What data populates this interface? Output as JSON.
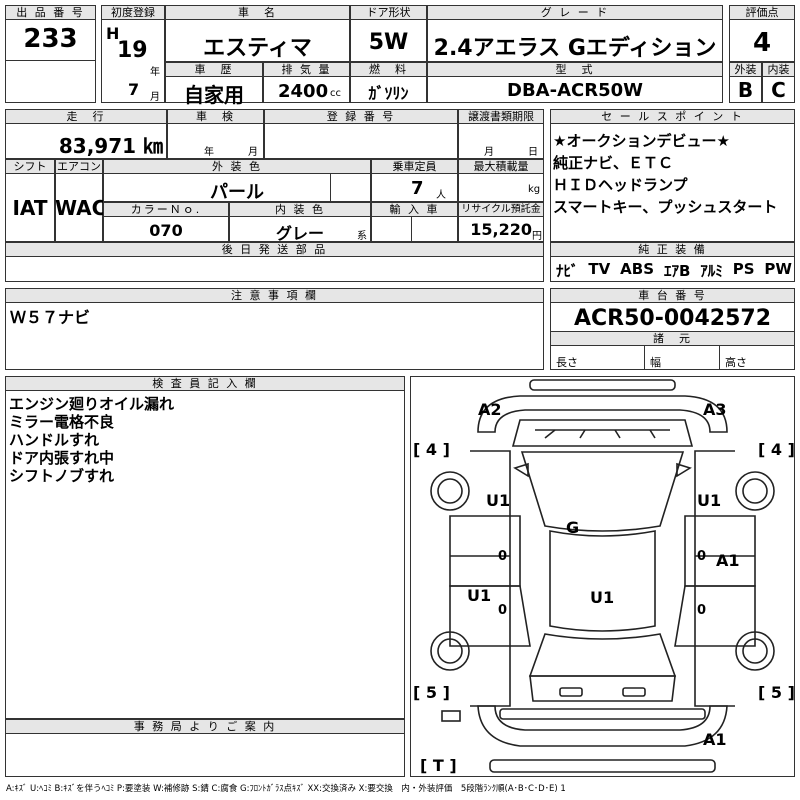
{
  "header": {
    "lot_no_label": "出 品 番 号",
    "lot_no": "233",
    "first_reg_label": "初度登録",
    "era_letter": "H",
    "year_num": "19",
    "year_unit": "年",
    "month_num": "7",
    "month_unit": "月",
    "car_name_label": "車　名",
    "car_name": "エスティマ",
    "door_label": "ドア形状",
    "door": "5W",
    "grade_label": "グ レ ー ド",
    "grade": "2.4アエラス Gエディション",
    "score_label": "評価点",
    "score": "4",
    "history_label": "車　歴",
    "history": "自家用",
    "displacement_label": "排 気 量",
    "displacement": "2400",
    "displacement_unit": "cc",
    "fuel_label": "燃　料",
    "fuel": "ｶﾞｿﾘﾝ",
    "model_label": "型　式",
    "model": "DBA-ACR50W",
    "exterior_label": "外装",
    "exterior": "B",
    "interior_label": "内装",
    "interior": "C"
  },
  "row2": {
    "mileage_label": "走　行",
    "mileage": "83,971 ㎞",
    "inspection_label": "車　検",
    "inspection_year_unit": "年",
    "inspection_month_unit": "月",
    "regno_label": "登 録 番 号",
    "transfer_label": "譲渡書類期限",
    "transfer_month_unit": "月",
    "transfer_day_unit": "日",
    "shift_label": "シフト",
    "shift": "IAT",
    "ac_label": "エアコン",
    "ac": "WAC",
    "color_label": "外 装 色",
    "color": "パール",
    "capacity_label": "乗車定員",
    "capacity": "7",
    "capacity_unit": "人",
    "load_label": "最大積載量",
    "load_unit": "kg",
    "color_no_label": "カラーＮｏ.",
    "color_no": "070",
    "int_color_label": "内 装 色",
    "int_color": "グレー",
    "int_color_suffix": "系",
    "import_label": "輸 入 車",
    "recycle_label": "リサイクル預託金",
    "recycle": "15,220",
    "recycle_unit": "円",
    "later_parts_label": "後 日 発 送 部 品"
  },
  "sales": {
    "label": "セ ー ル ス ポ イ ン ト",
    "lines": [
      "★オークションデビュー★",
      "純正ナビ、ＥＴＣ",
      "ＨＩＤヘッドランプ",
      "スマートキー、プッシュスタート"
    ]
  },
  "equipment": {
    "label": "純 正 装 備",
    "items": [
      "ﾅﾋﾞ",
      "TV",
      "ABS",
      "ｴｱB",
      "ｱﾙﾐ",
      "PS",
      "PW"
    ]
  },
  "notes": {
    "label": "注 意 事 項 欄",
    "text": "Ｗ５７ナビ"
  },
  "chassis": {
    "label": "車 台 番 号",
    "value": "ACR50-0042572",
    "spec_label": "諸　元",
    "length_label": "長さ",
    "width_label": "幅",
    "height_label": "高さ"
  },
  "inspector": {
    "label": "検 査 員 記 入 欄",
    "lines": [
      "エンジン廻りオイル漏れ",
      "ミラー電格不良",
      "ハンドルすれ",
      "ドア内張すれ中",
      "シフトノブすれ"
    ]
  },
  "office": {
    "label": "事 務 局 よ り ご 案 内"
  },
  "diagram": {
    "marks": {
      "a2_tl": "A2",
      "a3_tr": "A3",
      "u1_left": "U1",
      "u1_right": "U1",
      "g_center": "G",
      "a1_right": "A1",
      "u1_lower_left": "U1",
      "u1_lower_center": "U1",
      "a1_bottom": "A1"
    },
    "tire_tl": "[ 4 ]",
    "tire_tr": "[ 4 ]",
    "tire_bl": "[ 5 ]",
    "tire_br": "[ 5 ]",
    "tire_t": "[ T ]",
    "zero_l": "0",
    "zero_r": "0",
    "zero_l2": "0",
    "zero_r2": "0"
  },
  "legend": "A:ｷｽﾞ U:ﾍｺﾐ B:ｷｽﾞを伴うﾍｺﾐ P:要塗装 W:補修跡 S:錆 C:腐食 G:ﾌﾛﾝﾄｶﾞﾗｽ点ｷｽﾞ XX:交換済み X:要交換　内・外装評価　5段階ﾗﾝｸ順(A･B･C･D･E) 1"
}
